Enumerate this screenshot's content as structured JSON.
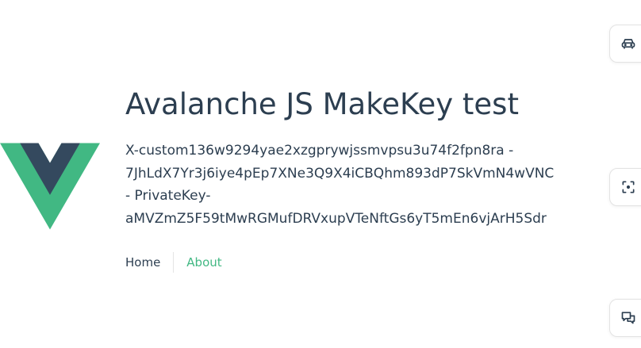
{
  "app": {
    "title": "Avalanche JS MakeKey test",
    "key_lines": [
      "X-custom136w9294yae2xzgprywjssmvpsu3u74f2fpn8ra -",
      "7JhLdX7Yr3j6iye4pEp7XNe3Q9X4iCBQhm893dP7SkVmN4wVNC",
      "- PrivateKey-",
      "aMVZmZ5F59tMwRGMufDRVxupVTeNftGs6yT5mEn6vjArH5Sdr"
    ]
  },
  "nav": {
    "home_label": "Home",
    "about_label": "About"
  },
  "side_tabs": [
    {
      "icon": "car-icon"
    },
    {
      "icon": "scan-icon"
    },
    {
      "icon": "chat-icon"
    }
  ],
  "colors": {
    "text": "#2c3e50",
    "accent": "#42b883",
    "logo_green": "#41b883",
    "logo_dark": "#34495e"
  }
}
